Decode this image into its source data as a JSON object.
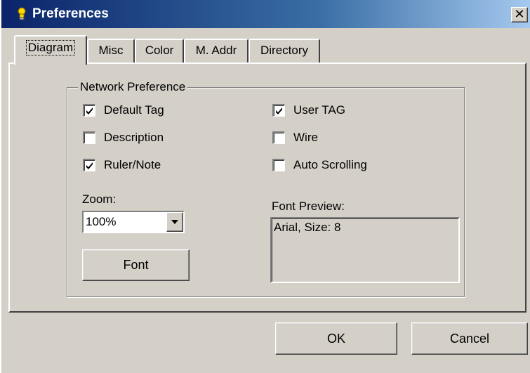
{
  "window": {
    "title": "Preferences",
    "close_glyph": "✕"
  },
  "tabs": [
    {
      "label": "Diagram",
      "active": true
    },
    {
      "label": "Misc",
      "active": false
    },
    {
      "label": "Color",
      "active": false
    },
    {
      "label": "M. Addr",
      "active": false
    },
    {
      "label": "Directory",
      "active": false
    }
  ],
  "network_preference": {
    "title": "Network Preference",
    "checkboxes": [
      {
        "label": "Default Tag",
        "checked": true
      },
      {
        "label": "Description",
        "checked": false
      },
      {
        "label": "Ruler/Note",
        "checked": true
      },
      {
        "label": "User TAG",
        "checked": true
      },
      {
        "label": "Wire",
        "checked": false
      },
      {
        "label": "Auto Scrolling",
        "checked": false
      }
    ],
    "zoom": {
      "label": "Zoom:",
      "value": "100%"
    },
    "font_button_label": "Font",
    "font_preview": {
      "label": "Font Preview:",
      "text": "Arial, Size: 8"
    }
  },
  "buttons": {
    "ok": "OK",
    "cancel": "Cancel"
  },
  "icons": {
    "title_icon": "lightbulb-icon",
    "close_icon": "close-icon",
    "dropdown_icon": "chevron-down-icon",
    "check_icon": "checkmark-icon"
  },
  "colors": {
    "title_bar_start": "#0a246a",
    "title_bar_end": "#a6caf0",
    "face": "#d4d0c8"
  }
}
